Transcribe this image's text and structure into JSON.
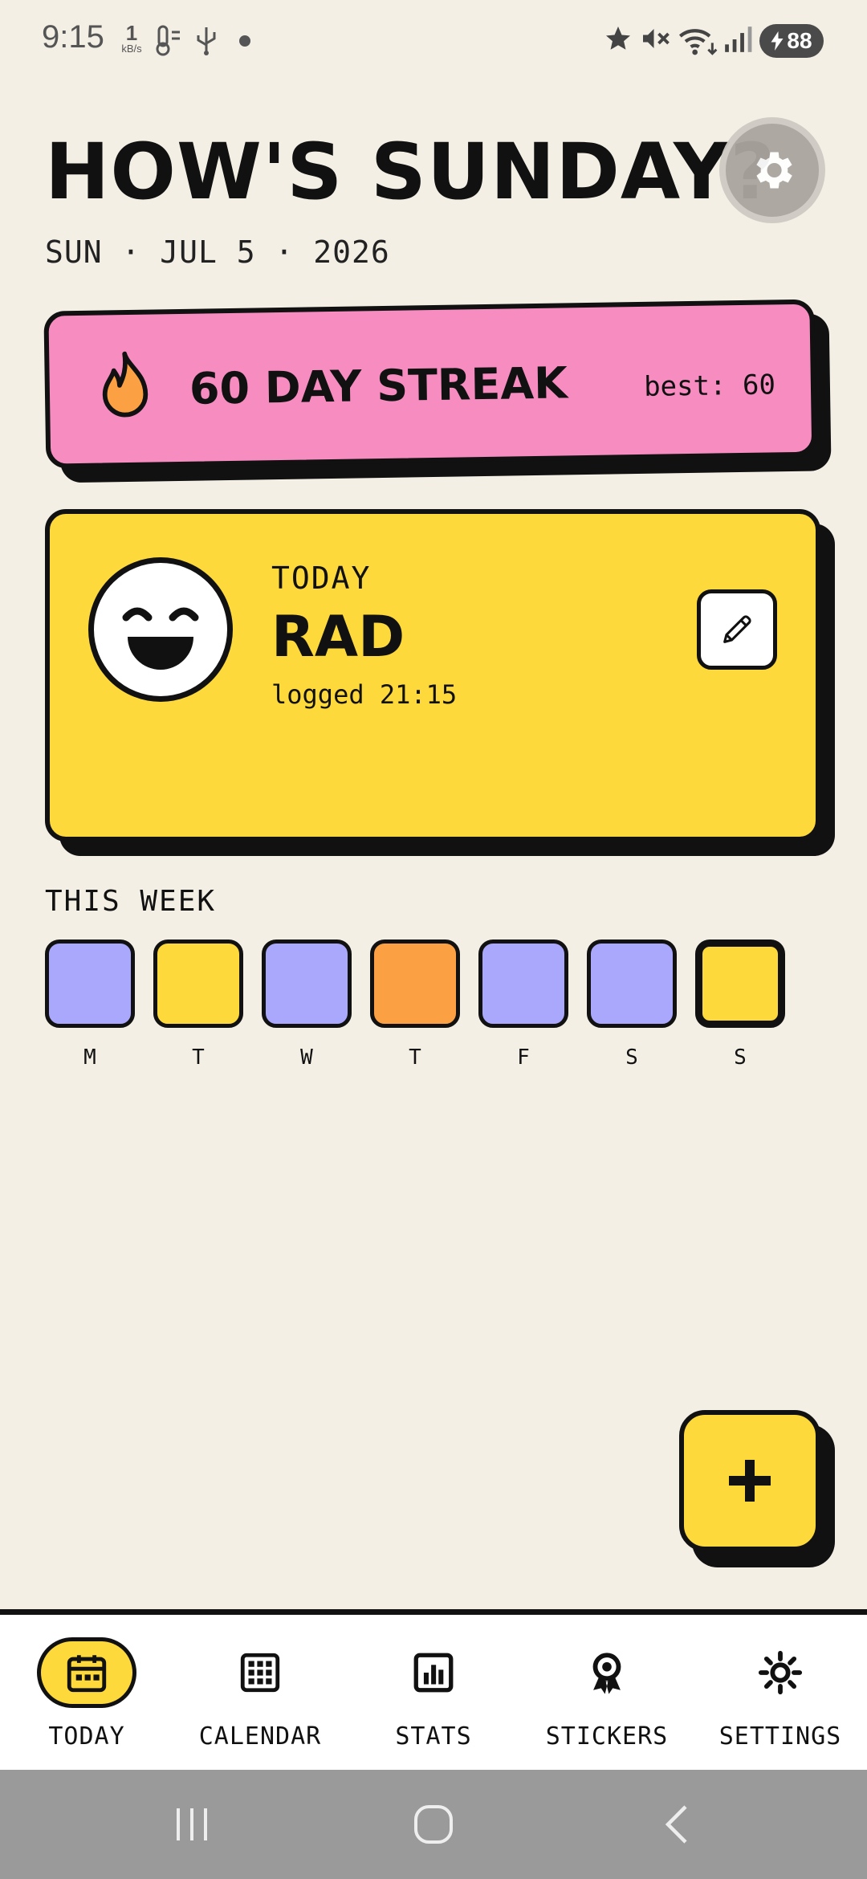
{
  "status_bar": {
    "time": "9:15",
    "net_speed_value": "1",
    "net_speed_unit": "kB/s",
    "battery": "88",
    "icons": [
      "thermometer-icon",
      "usb-icon",
      "star-icon",
      "mute-icon",
      "wifi-icon",
      "signal-icon",
      "battery-icon"
    ]
  },
  "header": {
    "title": "HOW'S SUNDAY?",
    "date": "SUN · JUL 5 · 2026",
    "settings_icon": "gear-icon"
  },
  "streak": {
    "text": "60 DAY STREAK",
    "best": "best: 60",
    "icon": "flame-icon",
    "color": "#F78CC0"
  },
  "today": {
    "label": "TODAY",
    "mood": "RAD",
    "logged": "logged 21:15",
    "edit_icon": "pencil-icon",
    "color": "#FDD93B"
  },
  "week": {
    "title": "THIS WEEK",
    "days": [
      {
        "letter": "M",
        "color": "#A9A8FC"
      },
      {
        "letter": "T",
        "color": "#FDD93B"
      },
      {
        "letter": "W",
        "color": "#A9A8FC"
      },
      {
        "letter": "T",
        "color": "#FCA143"
      },
      {
        "letter": "F",
        "color": "#A9A8FC"
      },
      {
        "letter": "S",
        "color": "#A9A8FC"
      },
      {
        "letter": "S",
        "color": "#FDD93B"
      }
    ]
  },
  "fab": {
    "icon": "plus-icon"
  },
  "nav": {
    "items": [
      {
        "label": "TODAY",
        "icon": "calendar-today-icon",
        "active": true
      },
      {
        "label": "CALENDAR",
        "icon": "calendar-grid-icon",
        "active": false
      },
      {
        "label": "STATS",
        "icon": "bar-chart-icon",
        "active": false
      },
      {
        "label": "STICKERS",
        "icon": "badge-icon",
        "active": false
      },
      {
        "label": "SETTINGS",
        "icon": "sun-gear-icon",
        "active": false
      }
    ]
  }
}
